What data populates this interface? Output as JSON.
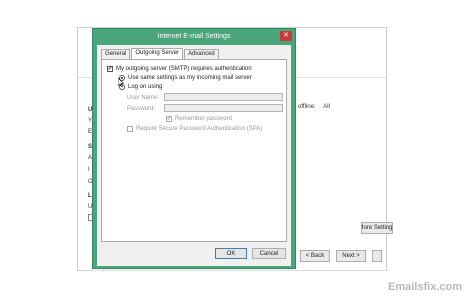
{
  "dialog": {
    "title": "Internet E-mail Settings",
    "close_glyph": "✕",
    "tabs": [
      {
        "label": "General",
        "active": false
      },
      {
        "label": "Outgoing Server",
        "active": true
      },
      {
        "label": "Advanced",
        "active": false
      }
    ],
    "requires_auth": {
      "label": "My outgoing server (SMTP) requires authentication",
      "checked": true
    },
    "use_same": {
      "label": "Use same settings as my incoming mail server",
      "selected": true
    },
    "log_on_using": {
      "label": "Log on using",
      "selected": false
    },
    "user_name": {
      "label": "User Name:",
      "value": ""
    },
    "password": {
      "label": "Password:",
      "value": ""
    },
    "remember_password": {
      "label": "Remember password",
      "checked": true
    },
    "spa": {
      "label": "Require Secure Password Authentication (SPA)",
      "checked": false
    },
    "ok_label": "OK",
    "cancel_label": "Cancel"
  },
  "background": {
    "offline_label": "offline:",
    "offline_value": "All",
    "more_settings_label": "More Settings",
    "back_label": "< Back",
    "next_label": "Next >",
    "left_letters": [
      "U",
      "Y",
      "E",
      "S",
      "A",
      "I",
      "O",
      "L",
      "U",
      "P"
    ]
  },
  "watermark": "Emailsfix.com",
  "colors": {
    "dialog_frame": "#4aa67a",
    "close_button": "#c9393b",
    "default_button_border": "#3c7fb1"
  }
}
